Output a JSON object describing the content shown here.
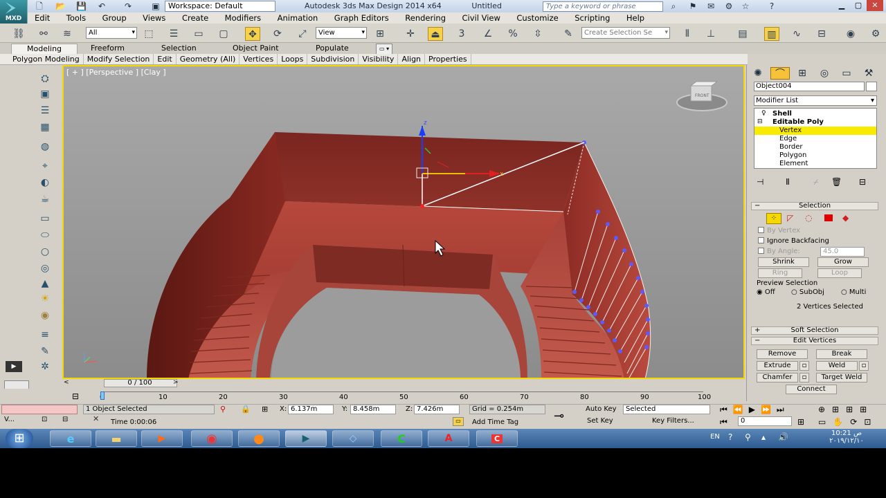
{
  "title_bar": {
    "logo_text": "MXD",
    "workspace": "Workspace: Default",
    "app_title": "Autodesk 3ds Max Design 2014 x64",
    "doc_title": "Untitled",
    "search_placeholder": "Type a keyword or phrase"
  },
  "menu": [
    "Edit",
    "Tools",
    "Group",
    "Views",
    "Create",
    "Modifiers",
    "Animation",
    "Graph Editors",
    "Rendering",
    "Civil View",
    "Customize",
    "Scripting",
    "Help"
  ],
  "toolbar": {
    "selection_filter": "All",
    "ref_coord": "View",
    "snap_number": "3",
    "named_selection": "Create Selection Se"
  },
  "ribbon": {
    "tabs": [
      "Modeling",
      "Freeform",
      "Selection",
      "Object Paint",
      "Populate"
    ],
    "subtabs": [
      "Polygon Modeling",
      "Modify Selection",
      "Edit",
      "Geometry (All)",
      "Vertices",
      "Loops",
      "Subdivision",
      "Visibility",
      "Align",
      "Properties"
    ]
  },
  "viewport": {
    "label": "[ + ] [Perspective ] [Clay ]",
    "viewcube_label": "FRONT",
    "gizmo_z": "z",
    "gizmo_x": "x"
  },
  "command_panel": {
    "object_name": "Object004",
    "modifier_list": "Modifier List",
    "stack": [
      {
        "label": "Shell",
        "level": 0,
        "bold": true,
        "selected": false
      },
      {
        "label": "Editable Poly",
        "level": 0,
        "bold": true,
        "selected": false
      },
      {
        "label": "Vertex",
        "level": 1,
        "bold": false,
        "selected": true
      },
      {
        "label": "Edge",
        "level": 1,
        "bold": false,
        "selected": false
      },
      {
        "label": "Border",
        "level": 1,
        "bold": false,
        "selected": false
      },
      {
        "label": "Polygon",
        "level": 1,
        "bold": false,
        "selected": false
      },
      {
        "label": "Element",
        "level": 1,
        "bold": false,
        "selected": false
      }
    ],
    "selection": {
      "title": "Selection",
      "by_vertex": "By Vertex",
      "ignore_backfacing": "Ignore Backfacing",
      "by_angle": "By Angle:",
      "angle_value": "45.0",
      "shrink": "Shrink",
      "grow": "Grow",
      "ring": "Ring",
      "loop": "Loop",
      "preview_title": "Preview Selection",
      "preview_off": "Off",
      "preview_subobj": "SubObj",
      "preview_multi": "Multi",
      "status": "2 Vertices Selected"
    },
    "soft_selection": "Soft Selection",
    "edit_vertices": {
      "title": "Edit Vertices",
      "remove": "Remove",
      "break": "Break",
      "extrude": "Extrude",
      "weld": "Weld",
      "chamfer": "Chamfer",
      "target_weld": "Target Weld",
      "connect": "Connect"
    }
  },
  "timeline": {
    "slider_label": "0 / 100",
    "ticks": [
      "0",
      "10",
      "20",
      "30",
      "40",
      "50",
      "60",
      "70",
      "80",
      "90",
      "100"
    ]
  },
  "status_bar": {
    "maxscript": "V...",
    "selection_info": "1 Object Selected",
    "x_value": "6.137m",
    "y_value": "8.458m",
    "z_value": "7.426m",
    "grid": "Grid = 0.254m",
    "time": "Time  0:00:06",
    "add_time_tag": "Add Time Tag",
    "auto_key": "Auto Key",
    "key_mode": "Selected",
    "set_key": "Set Key",
    "key_filters": "Key Filters...",
    "frame": "0"
  },
  "taskbar": {
    "lang": "EN",
    "time": "10:21 ص",
    "date": "٢٠١٩/١٢/١٠"
  }
}
